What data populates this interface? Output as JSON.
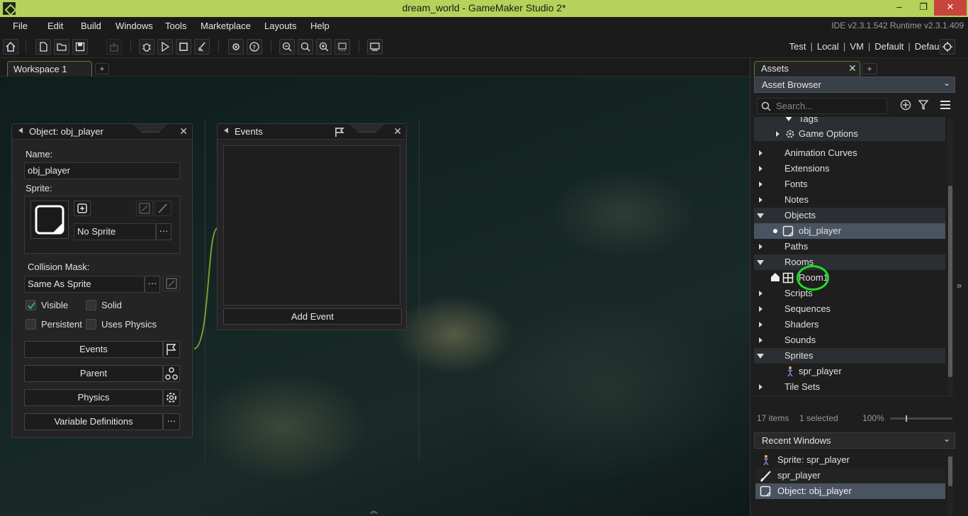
{
  "window": {
    "title": "dream_world - GameMaker Studio 2*",
    "minimize": "‒",
    "maximize": "❐",
    "close": "✕"
  },
  "menu": {
    "items": [
      "File",
      "Edit",
      "Build",
      "Windows",
      "Tools",
      "Marketplace",
      "Layouts",
      "Help"
    ],
    "version": "IDE v2.3.1.542  Runtime v2.3.1.409"
  },
  "targets": {
    "config1": "Test",
    "config2": "Local",
    "config3": "VM",
    "config4": "Default",
    "config5": "Default"
  },
  "workspace": {
    "tab_label": "Workspace 1",
    "add_tab": "+"
  },
  "object_panel": {
    "title": "Object: obj_player",
    "name_label": "Name:",
    "name_value": "obj_player",
    "sprite_label": "Sprite:",
    "sprite_value": "No Sprite",
    "collision_label": "Collision Mask:",
    "collision_value": "Same As Sprite",
    "visible_label": "Visible",
    "solid_label": "Solid",
    "persistent_label": "Persistent",
    "physics_label": "Uses Physics",
    "visible_checked": true,
    "events_btn": "Events",
    "parent_btn": "Parent",
    "physics_btn": "Physics",
    "variables_btn": "Variable Definitions",
    "dots": "···"
  },
  "events_panel": {
    "title": "Events",
    "add_event": "Add Event"
  },
  "assets": {
    "tab_label": "Assets",
    "add_tab": "+",
    "browser_label": "Asset Browser",
    "search_placeholder": "Search...",
    "tree": {
      "tags": "Tags",
      "game_options": "Game Options",
      "animation_curves": "Animation Curves",
      "extensions": "Extensions",
      "fonts": "Fonts",
      "notes": "Notes",
      "objects": "Objects",
      "obj_player": "obj_player",
      "paths": "Paths",
      "rooms": "Rooms",
      "room1": "Room1",
      "scripts": "Scripts",
      "sequences": "Sequences",
      "shaders": "Shaders",
      "sounds": "Sounds",
      "sprites": "Sprites",
      "spr_player": "spr_player",
      "tile_sets": "Tile Sets"
    },
    "status_items": "17 items",
    "status_selected": "1 selected",
    "zoom": "100%"
  },
  "recent": {
    "label": "Recent Windows",
    "items": [
      "Sprite: spr_player",
      "spr_player",
      "Object: obj_player"
    ]
  },
  "colors": {
    "accent": "#b6d25a",
    "highlight_ring": "#22dd22",
    "selection": "#4a5360"
  }
}
